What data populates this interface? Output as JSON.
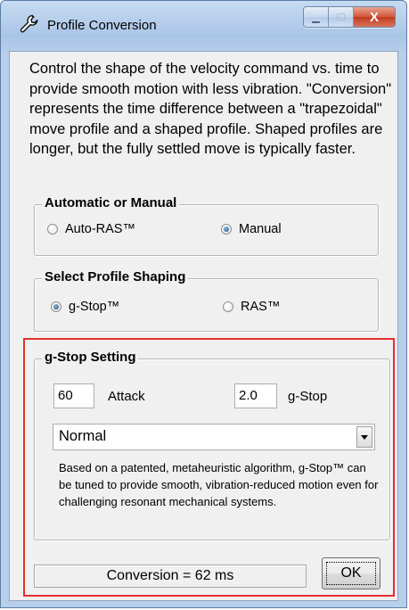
{
  "window": {
    "title": "Profile Conversion",
    "minimize_glyph": "▁",
    "maximize_glyph": "☐",
    "close_glyph": "X"
  },
  "description": "Control the shape of the velocity command vs. time to provide smooth motion with less vibration. \"Conversion\" represents the time difference between a \"trapezoidal\" move profile and a shaped profile. Shaped profiles are longer, but the fully settled move is typically faster.",
  "mode_group": {
    "label": "Automatic or Manual",
    "options": [
      {
        "label": "Auto-RAS™",
        "selected": false
      },
      {
        "label": "Manual",
        "selected": true
      }
    ]
  },
  "shaping_group": {
    "label": "Select Profile Shaping",
    "options": [
      {
        "label": "g-Stop™",
        "selected": true
      },
      {
        "label": "RAS™",
        "selected": false
      }
    ]
  },
  "gstop_group": {
    "label": "g-Stop Setting",
    "attack_value": "60",
    "attack_label": "Attack",
    "gstop_value": "2.0",
    "gstop_label": "g-Stop",
    "preset_value": "Normal",
    "note": "Based on a patented, metaheuristic algorithm, g-Stop™ can be tuned to provide smooth, vibration-reduced motion even for challenging resonant mechanical systems."
  },
  "status": "Conversion = 62 ms",
  "ok_label": "OK",
  "colors": {
    "highlight": "#e53030",
    "title_bar": "#b7cfeb"
  },
  "icons": {
    "title": "wrench-icon"
  }
}
